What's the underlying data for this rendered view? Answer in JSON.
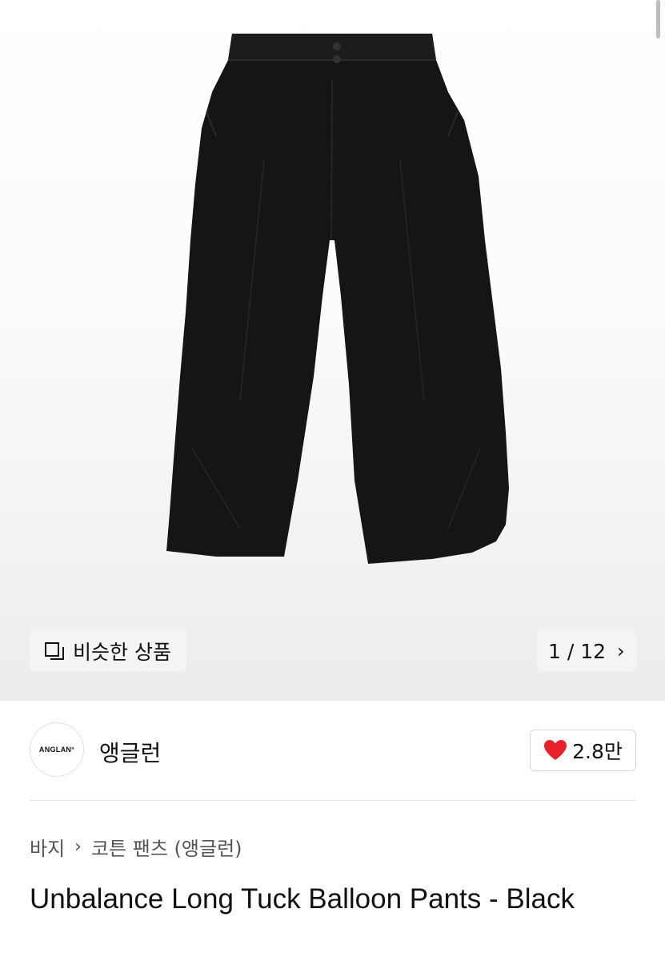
{
  "gallery": {
    "similar_label": "비슷한 상품",
    "counter": "1 / 12",
    "product_image": "black-balloon-pants-photo"
  },
  "brand": {
    "logo_text": "ANGLAN°",
    "name": "앵글런",
    "likes": "2.8만"
  },
  "breadcrumb": {
    "items": [
      "바지",
      "코튼 팬츠 (앵글런)"
    ],
    "separator": "›"
  },
  "product": {
    "title": "Unbalance Long Tuck Balloon Pants - Black"
  },
  "colors": {
    "heart": "#e8222b",
    "pill_bg": "#f4f4f4"
  }
}
